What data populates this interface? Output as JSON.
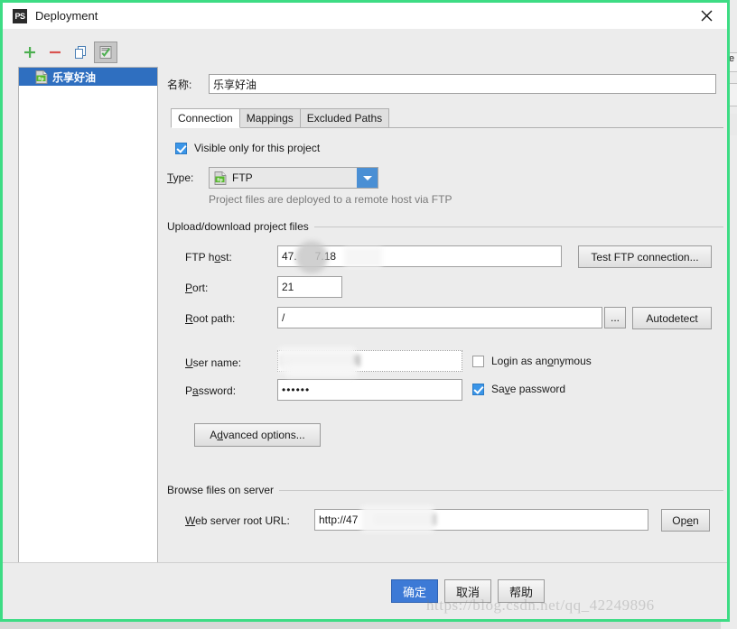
{
  "window": {
    "title": "Deployment",
    "app_icon": "phpstorm-icon",
    "close_icon": "close-icon",
    "border_color": "#3ddc84"
  },
  "left_pane": {
    "toolbar": [
      {
        "name": "add-server-button",
        "icon": "plus-icon",
        "pressed": false
      },
      {
        "name": "remove-server-button",
        "icon": "minus-icon",
        "pressed": false
      },
      {
        "name": "copy-server-button",
        "icon": "copy-icon",
        "pressed": false
      },
      {
        "name": "use-as-default-button",
        "icon": "check-list-icon",
        "pressed": true
      }
    ],
    "servers": [
      {
        "label": "乐享好油",
        "badge": "ftp",
        "selected": true
      }
    ]
  },
  "form": {
    "name_label": "名称:",
    "name_value": "乐享好油",
    "tabs": [
      {
        "label": "Connection",
        "active": true
      },
      {
        "label": "Mappings",
        "active": false
      },
      {
        "label": "Excluded Paths",
        "active": false
      }
    ],
    "visible_only": {
      "label": "Visible only for this project",
      "checked": true
    },
    "type": {
      "label": "Type:",
      "label_mnemonic": "T",
      "value": "FTP",
      "badge": "ftp",
      "hint": "Project files are deployed to a remote host via FTP",
      "arrow_icon": "chevron-down-icon"
    },
    "upload_group": {
      "title": "Upload/download project files",
      "host_label": "FTP host:",
      "host_label_pre": "FTP h",
      "host_label_mnemonic": "o",
      "host_label_post": "st:",
      "host_value": "47.      7.18",
      "test_button": "Test FTP connection...",
      "port_label": "Port:",
      "port_value": "21",
      "root_label": "Root path:",
      "root_value": "/",
      "browse_button": "...",
      "autodetect_button": "Autodetect",
      "username_label": "User name:",
      "username_value": "",
      "login_anonymous_label": "Login as anonymous",
      "login_anonymous_checked": false,
      "password_label": "Password:",
      "password_value": "••••••",
      "save_password_label": "Save password",
      "save_password_checked": true,
      "advanced_button": "Advanced options..."
    },
    "browse_group": {
      "title": "Browse files on server",
      "url_label": "Web server root URL:",
      "url_value": "http://47",
      "open_button": "Open"
    }
  },
  "footer": {
    "ok_button": "确定",
    "cancel_button": "取消",
    "help_button": "帮助"
  },
  "watermark": "https://blog.csdn.net/qq_42249896",
  "background_window": {
    "fragment_text": "Re"
  }
}
